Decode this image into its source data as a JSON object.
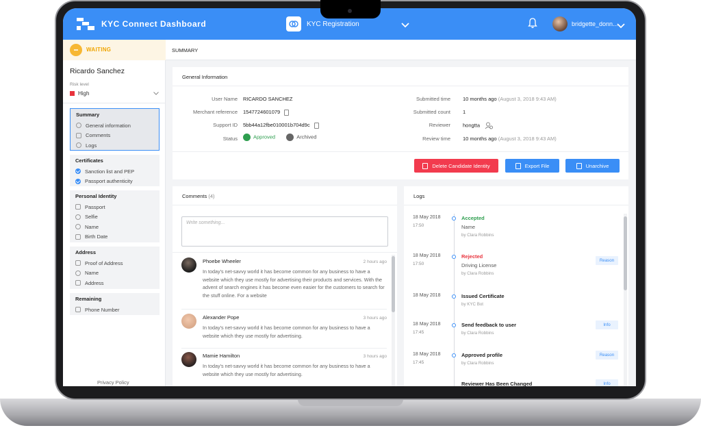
{
  "header": {
    "app_title": "KYC Connect Dashboard",
    "module_label": "KYC Registration",
    "user_name": "bridgette_donn...",
    "brand_color": "#3a8ef6"
  },
  "sidebar": {
    "status_label": "WAITING",
    "customer_name": "Ricardo Sanchez",
    "risk_caption": "Risk level",
    "risk_value": "High",
    "groups": [
      {
        "title": "Summary",
        "items": [
          "General information",
          "Comments",
          "Logs"
        ]
      },
      {
        "title": "Certificates",
        "items": [
          "Sanction list and PEP",
          "Passport authenticity"
        ]
      },
      {
        "title": "Personal Identity",
        "items": [
          "Passport",
          "Selfie",
          "Name",
          "Birth Date"
        ]
      },
      {
        "title": "Address",
        "items": [
          "Proof of Address",
          "Name",
          "Address"
        ]
      },
      {
        "title": "Remaining",
        "items": [
          "Phone Number"
        ]
      }
    ],
    "privacy_link": "Privacy Policy"
  },
  "breadcrumb": "SUMMARY",
  "general": {
    "title": "General Information",
    "left": [
      {
        "label": "User Name",
        "value": "RICARDO SANCHEZ"
      },
      {
        "label": "Merchant reference",
        "value": "1547724601079"
      },
      {
        "label": "Support ID",
        "value": "5bb44a12fbe010001b704d9c"
      },
      {
        "label": "Status",
        "value": "Approved",
        "value2": "Archived"
      }
    ],
    "right": [
      {
        "label": "Submitted time",
        "value": "10 months ago",
        "muted": "(August 3, 2018 9:43 AM)"
      },
      {
        "label": "Submitted count",
        "value": "1"
      },
      {
        "label": "Reviewer",
        "value": "hongtta"
      },
      {
        "label": "Review time",
        "value": "10 months ago",
        "muted": "(August 3, 2018 9:43 AM)"
      }
    ],
    "buttons": {
      "delete": "Delete Candidate Identity",
      "export": "Export File",
      "unarchive": "Unarchive"
    }
  },
  "comments": {
    "title": "Comments",
    "count": "(4)",
    "placeholder": "Write something...",
    "items": [
      {
        "name": "Phoebe Wheeler",
        "time": "2 hours ago",
        "body": "In today's net-savvy world it has become common for any business to have a website which they use mostly for advertising their products and services. With the advent of search engines it has become even easier for the customers to search for the stuff online. For a website"
      },
      {
        "name": "Alexander Pope",
        "time": "3 hours ago",
        "body": "In today's net-savvy world it has become common for any business to have a website which they use mostly for advertising."
      },
      {
        "name": "Mamie Hamilton",
        "time": "3 hours ago",
        "body": "In today's net-savvy world it has become common for any business to have a website which they use mostly for advertising."
      }
    ]
  },
  "logs": {
    "title": "Logs",
    "items": [
      {
        "date": "18 May 2018",
        "time": "17:50",
        "title": "Accepted",
        "color": "#2e9e4f",
        "sub": "Name",
        "by": "by Clara Robbins",
        "tag": ""
      },
      {
        "date": "18 May 2018",
        "time": "17:50",
        "title": "Rejected",
        "color": "#e8333d",
        "sub": "Driving License",
        "by": "by Clara Robbins",
        "tag": "Reason"
      },
      {
        "date": "18 May 2018",
        "time": "",
        "title": "Issued Certificate",
        "color": "#222222",
        "sub": "",
        "by": "by KYC Bot",
        "tag": ""
      },
      {
        "date": "18 May 2018",
        "time": "17:45",
        "title": "Send feedback to user",
        "color": "#222222",
        "sub": "",
        "by": "by Clara Robbins",
        "tag": "Info"
      },
      {
        "date": "18 May 2018",
        "time": "17:45",
        "title": "Approved profile",
        "color": "#222222",
        "sub": "",
        "by": "by Clara Robbins",
        "tag": "Reason"
      },
      {
        "date": "",
        "time": "",
        "title": "Reviewer Has Been Changed",
        "color": "#222222",
        "sub": "",
        "by": "",
        "tag": "Info"
      }
    ]
  }
}
